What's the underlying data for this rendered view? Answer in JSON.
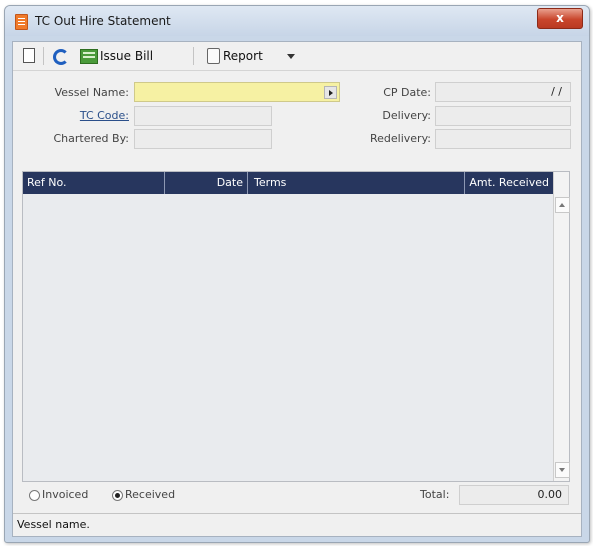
{
  "window": {
    "title": "TC Out Hire Statement",
    "close_glyph": "x"
  },
  "toolbar": {
    "issue_bill_label": "Issue Bill",
    "report_label": "Report"
  },
  "form": {
    "vessel_name_label": "Vessel Name:",
    "tc_code_label": "TC Code:",
    "chartered_by_label": "Chartered By:",
    "cp_date_label": "CP Date:",
    "cp_date_value": "/ /",
    "delivery_label": "Delivery:",
    "redelivery_label": "Redelivery:"
  },
  "grid": {
    "columns": [
      "Ref No.",
      "Date",
      "Terms",
      "Amt. Received"
    ],
    "rows": []
  },
  "footer": {
    "invoiced_label": "Invoiced",
    "received_label": "Received",
    "selected": "Received",
    "total_label": "Total:",
    "total_value": "0.00"
  },
  "status": {
    "text": "Vessel name."
  },
  "colors": {
    "grid_header": "#27365e",
    "required_field": "#f6f1a3",
    "close_button": "#c9462c"
  },
  "icons": [
    "document-icon",
    "refresh-icon",
    "bill-icon",
    "report-icon",
    "chevron-down-icon",
    "app-icon",
    "close-icon"
  ]
}
